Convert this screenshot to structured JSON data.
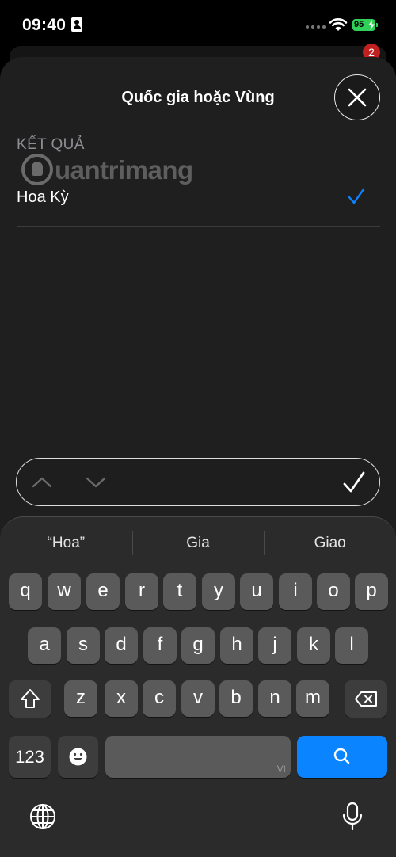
{
  "status_bar": {
    "time": "09:40",
    "battery": "95"
  },
  "background": {
    "badge_count": "2"
  },
  "sheet": {
    "title": "Quốc gia hoặc Vùng",
    "section_header": "KẾT QUẢ",
    "results": [
      {
        "label": "Hoa Kỳ",
        "selected": true
      }
    ],
    "watermark": "uantrimang"
  },
  "keyboard": {
    "suggestions": [
      "“Hoa”",
      "Gia",
      "Giao"
    ],
    "row1": [
      "q",
      "w",
      "e",
      "r",
      "t",
      "y",
      "u",
      "i",
      "o",
      "p"
    ],
    "row2": [
      "a",
      "s",
      "d",
      "f",
      "g",
      "h",
      "j",
      "k",
      "l"
    ],
    "row3": [
      "z",
      "x",
      "c",
      "v",
      "b",
      "n",
      "m"
    ],
    "numbers_label": "123",
    "space_language": "VI"
  },
  "colors": {
    "accent": "#0a84ff",
    "battery": "#2fd158",
    "badge": "#c0201f",
    "sheet": "#1f1f1f",
    "key": "#5a5a5a"
  }
}
